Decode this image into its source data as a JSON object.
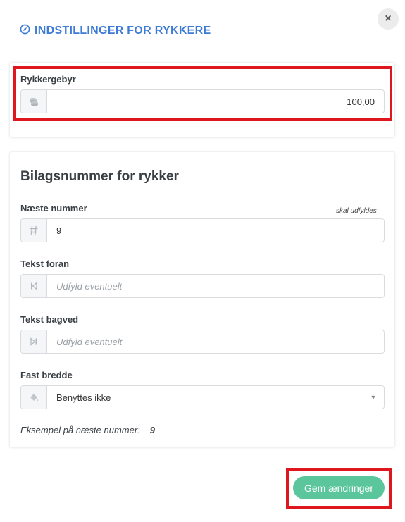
{
  "dialog": {
    "title": "INDSTILLINGER FOR RYKKERE",
    "close_label": "×"
  },
  "fee": {
    "label": "Rykkergebyr",
    "value": "100,00",
    "icon": "coins-icon"
  },
  "voucher": {
    "heading": "Bilagsnummer for rykker",
    "next_number": {
      "label": "Næste nummer",
      "hint": "skal udfyldes",
      "value": "9",
      "icon": "hash-icon"
    },
    "prefix": {
      "label": "Tekst foran",
      "placeholder": "Udfyld eventuelt",
      "icon": "step-backward-icon"
    },
    "suffix": {
      "label": "Tekst bagved",
      "placeholder": "Udfyld eventuelt",
      "icon": "step-forward-icon"
    },
    "fixed_width": {
      "label": "Fast bredde",
      "selected": "Benyttes ikke",
      "icon": "paint-bucket-icon"
    },
    "example_label": "Eksempel på næste nummer:",
    "example_value": "9"
  },
  "actions": {
    "save_label": "Gem ændringer"
  },
  "colors": {
    "accent_blue": "#3d7bd5",
    "save_green": "#5bc69c",
    "highlight_red": "#e0161f"
  }
}
